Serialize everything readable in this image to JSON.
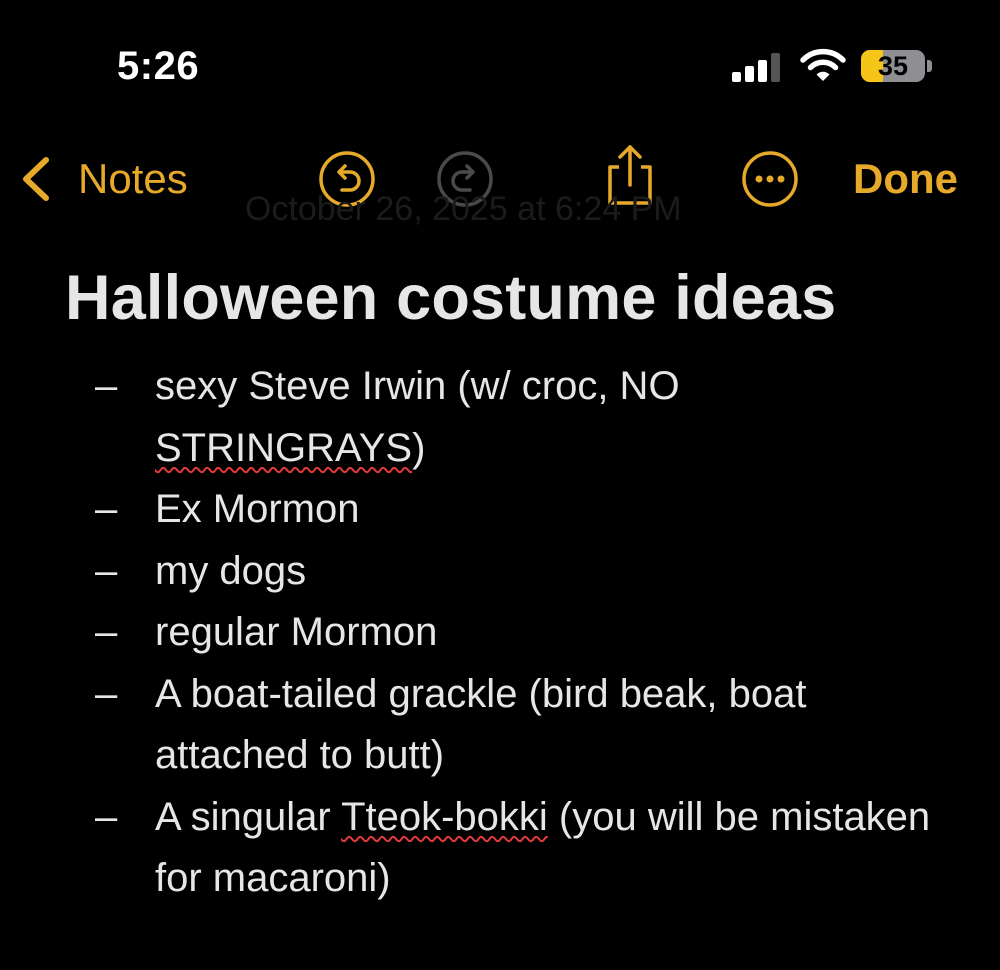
{
  "status_bar": {
    "time": "5:26",
    "battery_level": "35",
    "battery_fraction": 0.35,
    "signal_bars_active": 3,
    "signal_bars_total": 4
  },
  "nav": {
    "back_label": "Notes",
    "done_label": "Done",
    "accent_color": "#e6a92a",
    "icons": [
      "chevron-left-icon",
      "undo-icon",
      "redo-icon",
      "share-icon",
      "more-icon"
    ]
  },
  "note": {
    "date_text": "October 26, 2025 at 6:24 PM",
    "title": "Halloween costume ideas",
    "items": [
      {
        "bullet": "–",
        "segments": [
          {
            "text": "sexy Steve Irwin (w/ croc, NO "
          },
          {
            "text": "STRINGRAYS",
            "misspelled": true
          },
          {
            "text": ")"
          }
        ]
      },
      {
        "bullet": "–",
        "segments": [
          {
            "text": "Ex Mormon"
          }
        ]
      },
      {
        "bullet": "–",
        "segments": [
          {
            "text": "my dogs"
          }
        ]
      },
      {
        "bullet": "–",
        "segments": [
          {
            "text": "regular Mormon"
          }
        ]
      },
      {
        "bullet": "–",
        "segments": [
          {
            "text": "A boat-tailed grackle (bird beak, boat attached to butt)"
          }
        ]
      },
      {
        "bullet": "–",
        "segments": [
          {
            "text": "A singular "
          },
          {
            "text": "Tteok-bokki",
            "misspelled": true
          },
          {
            "text": " (you will be mistaken for macaroni)"
          }
        ]
      }
    ]
  }
}
